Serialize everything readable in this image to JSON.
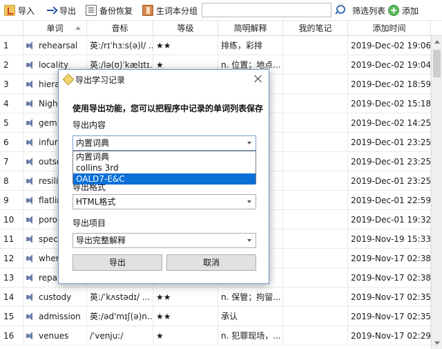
{
  "toolbar": {
    "import_label": "导入",
    "export_label": "导出",
    "backup_label": "备份恢复",
    "group_label": "生词本分组",
    "search_value": "",
    "filter_label": "筛选列表",
    "add_label": "添加"
  },
  "table": {
    "columns": [
      "单词",
      "音标",
      "等级",
      "简明解释",
      "我的笔记",
      "添加时间"
    ],
    "rows": [
      {
        "idx": "1",
        "word": "rehearsal",
        "phonetic": "英:/rɪˈhɜːs(ə)l/ ...",
        "level": "★★",
        "meaning": "排练，彩排",
        "note": "",
        "time": "2019-Dec-02 19:06..."
      },
      {
        "idx": "2",
        "word": "locality",
        "phonetic": "英:/lə(ʊ)ˈkælɪtɪ...",
        "level": "★",
        "meaning": "n. 位置；地点...",
        "note": "",
        "time": "2019-Dec-02 19:04..."
      },
      {
        "idx": "3",
        "word": "hiera",
        "phonetic": "",
        "level": "",
        "meaning": "",
        "note": "",
        "time": "2019-Dec-02 18:59..."
      },
      {
        "idx": "4",
        "word": "Nigh",
        "phonetic": "",
        "level": "",
        "meaning": "",
        "note": "",
        "time": "2019-Dec-02 15:18..."
      },
      {
        "idx": "5",
        "word": "gem",
        "phonetic": "",
        "level": "",
        "meaning": "",
        "note": "",
        "time": "2019-Dec-02 14:25..."
      },
      {
        "idx": "6",
        "word": "infuri",
        "phonetic": "",
        "level": "",
        "meaning": "",
        "note": "",
        "time": "2019-Dec-01 23:25..."
      },
      {
        "idx": "7",
        "word": "outso",
        "phonetic": "",
        "level": "",
        "meaning": "",
        "note": "",
        "time": "2019-Dec-01 23:25..."
      },
      {
        "idx": "8",
        "word": "resili",
        "phonetic": "",
        "level": "",
        "meaning": "",
        "note": "",
        "time": "2019-Dec-01 23:25..."
      },
      {
        "idx": "9",
        "word": "flatlir",
        "phonetic": "",
        "level": "",
        "meaning": "",
        "note": "",
        "time": "2019-Dec-01 22:59..."
      },
      {
        "idx": "10",
        "word": "poro",
        "phonetic": "",
        "level": "",
        "meaning": "",
        "note": "",
        "time": "2019-Dec-01 19:32..."
      },
      {
        "idx": "11",
        "word": "spec",
        "phonetic": "",
        "level": "",
        "meaning": "",
        "note": "",
        "time": "2019-Nov-19 15:33..."
      },
      {
        "idx": "12",
        "word": "wher",
        "phonetic": "",
        "level": "",
        "meaning": "",
        "note": "",
        "time": "2019-Nov-17 02:38..."
      },
      {
        "idx": "13",
        "word": "repa",
        "phonetic": "",
        "level": "",
        "meaning": "",
        "note": "",
        "time": "2019-Nov-17 02:38..."
      },
      {
        "idx": "14",
        "word": "custody",
        "phonetic": "英:/ˈkʌstədɪ/ ...",
        "level": "★★",
        "meaning": "n. 保管；拘留...",
        "note": "",
        "time": "2019-Nov-17 02:35..."
      },
      {
        "idx": "15",
        "word": "admission",
        "phonetic": "英:/əd'mɪʃ(ə)n...",
        "level": "★★",
        "meaning": "承认",
        "note": "",
        "time": "2019-Nov-17 02:35..."
      },
      {
        "idx": "16",
        "word": "venues",
        "phonetic": "/ˈvenjuː/",
        "level": "★",
        "meaning": "n. 犯罪现场，...",
        "note": "",
        "time": "2019-Nov-17 02:29..."
      }
    ]
  },
  "dialog": {
    "title": "导出学习记录",
    "description": "使用导出功能，您可以把程序中记录的单词列表保存",
    "content_label": "导出内容",
    "content_value": "内置词典",
    "content_options": [
      "内置词典",
      "collins 3rd",
      "OALD7-E&C"
    ],
    "content_highlighted": "OALD7-E&C",
    "format_label": "导出格式",
    "format_value": "HTML格式",
    "items_label": "导出项目",
    "items_value": "导出完整解释",
    "export_button": "导出",
    "cancel_button": "取消"
  }
}
